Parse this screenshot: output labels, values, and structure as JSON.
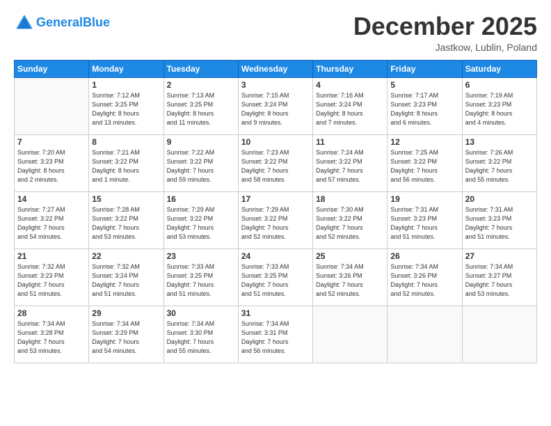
{
  "header": {
    "logo_line1": "General",
    "logo_line2": "Blue",
    "month": "December 2025",
    "location": "Jastkow, Lublin, Poland"
  },
  "days_of_week": [
    "Sunday",
    "Monday",
    "Tuesday",
    "Wednesday",
    "Thursday",
    "Friday",
    "Saturday"
  ],
  "weeks": [
    [
      {
        "day": "",
        "info": ""
      },
      {
        "day": "1",
        "info": "Sunrise: 7:12 AM\nSunset: 3:25 PM\nDaylight: 8 hours\nand 13 minutes."
      },
      {
        "day": "2",
        "info": "Sunrise: 7:13 AM\nSunset: 3:25 PM\nDaylight: 8 hours\nand 11 minutes."
      },
      {
        "day": "3",
        "info": "Sunrise: 7:15 AM\nSunset: 3:24 PM\nDaylight: 8 hours\nand 9 minutes."
      },
      {
        "day": "4",
        "info": "Sunrise: 7:16 AM\nSunset: 3:24 PM\nDaylight: 8 hours\nand 7 minutes."
      },
      {
        "day": "5",
        "info": "Sunrise: 7:17 AM\nSunset: 3:23 PM\nDaylight: 8 hours\nand 6 minutes."
      },
      {
        "day": "6",
        "info": "Sunrise: 7:19 AM\nSunset: 3:23 PM\nDaylight: 8 hours\nand 4 minutes."
      }
    ],
    [
      {
        "day": "7",
        "info": "Sunrise: 7:20 AM\nSunset: 3:23 PM\nDaylight: 8 hours\nand 2 minutes."
      },
      {
        "day": "8",
        "info": "Sunrise: 7:21 AM\nSunset: 3:22 PM\nDaylight: 8 hours\nand 1 minute."
      },
      {
        "day": "9",
        "info": "Sunrise: 7:22 AM\nSunset: 3:22 PM\nDaylight: 7 hours\nand 59 minutes."
      },
      {
        "day": "10",
        "info": "Sunrise: 7:23 AM\nSunset: 3:22 PM\nDaylight: 7 hours\nand 58 minutes."
      },
      {
        "day": "11",
        "info": "Sunrise: 7:24 AM\nSunset: 3:22 PM\nDaylight: 7 hours\nand 57 minutes."
      },
      {
        "day": "12",
        "info": "Sunrise: 7:25 AM\nSunset: 3:22 PM\nDaylight: 7 hours\nand 56 minutes."
      },
      {
        "day": "13",
        "info": "Sunrise: 7:26 AM\nSunset: 3:22 PM\nDaylight: 7 hours\nand 55 minutes."
      }
    ],
    [
      {
        "day": "14",
        "info": "Sunrise: 7:27 AM\nSunset: 3:22 PM\nDaylight: 7 hours\nand 54 minutes."
      },
      {
        "day": "15",
        "info": "Sunrise: 7:28 AM\nSunset: 3:22 PM\nDaylight: 7 hours\nand 53 minutes."
      },
      {
        "day": "16",
        "info": "Sunrise: 7:29 AM\nSunset: 3:22 PM\nDaylight: 7 hours\nand 53 minutes."
      },
      {
        "day": "17",
        "info": "Sunrise: 7:29 AM\nSunset: 3:22 PM\nDaylight: 7 hours\nand 52 minutes."
      },
      {
        "day": "18",
        "info": "Sunrise: 7:30 AM\nSunset: 3:22 PM\nDaylight: 7 hours\nand 52 minutes."
      },
      {
        "day": "19",
        "info": "Sunrise: 7:31 AM\nSunset: 3:23 PM\nDaylight: 7 hours\nand 51 minutes."
      },
      {
        "day": "20",
        "info": "Sunrise: 7:31 AM\nSunset: 3:23 PM\nDaylight: 7 hours\nand 51 minutes."
      }
    ],
    [
      {
        "day": "21",
        "info": "Sunrise: 7:32 AM\nSunset: 3:23 PM\nDaylight: 7 hours\nand 51 minutes."
      },
      {
        "day": "22",
        "info": "Sunrise: 7:32 AM\nSunset: 3:24 PM\nDaylight: 7 hours\nand 51 minutes."
      },
      {
        "day": "23",
        "info": "Sunrise: 7:33 AM\nSunset: 3:25 PM\nDaylight: 7 hours\nand 51 minutes."
      },
      {
        "day": "24",
        "info": "Sunrise: 7:33 AM\nSunset: 3:25 PM\nDaylight: 7 hours\nand 51 minutes."
      },
      {
        "day": "25",
        "info": "Sunrise: 7:34 AM\nSunset: 3:26 PM\nDaylight: 7 hours\nand 52 minutes."
      },
      {
        "day": "26",
        "info": "Sunrise: 7:34 AM\nSunset: 3:26 PM\nDaylight: 7 hours\nand 52 minutes."
      },
      {
        "day": "27",
        "info": "Sunrise: 7:34 AM\nSunset: 3:27 PM\nDaylight: 7 hours\nand 53 minutes."
      }
    ],
    [
      {
        "day": "28",
        "info": "Sunrise: 7:34 AM\nSunset: 3:28 PM\nDaylight: 7 hours\nand 53 minutes."
      },
      {
        "day": "29",
        "info": "Sunrise: 7:34 AM\nSunset: 3:29 PM\nDaylight: 7 hours\nand 54 minutes."
      },
      {
        "day": "30",
        "info": "Sunrise: 7:34 AM\nSunset: 3:30 PM\nDaylight: 7 hours\nand 55 minutes."
      },
      {
        "day": "31",
        "info": "Sunrise: 7:34 AM\nSunset: 3:31 PM\nDaylight: 7 hours\nand 56 minutes."
      },
      {
        "day": "",
        "info": ""
      },
      {
        "day": "",
        "info": ""
      },
      {
        "day": "",
        "info": ""
      }
    ]
  ]
}
